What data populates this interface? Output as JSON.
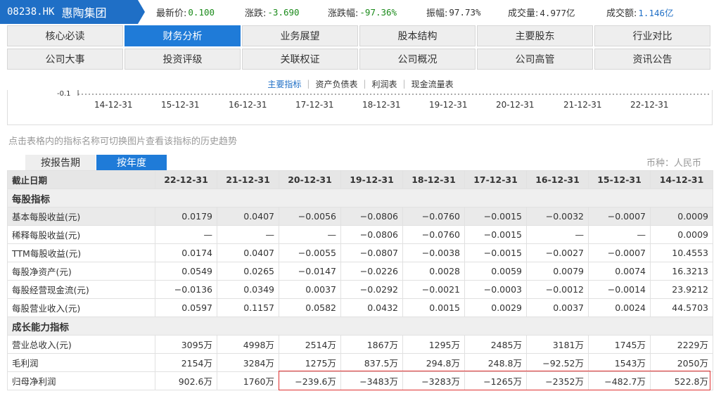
{
  "header": {
    "code": "08238.HK",
    "name": "惠陶集团",
    "quotes": [
      {
        "label": "最新价:",
        "value": "0.100",
        "color": "green"
      },
      {
        "label": "涨跌:",
        "value": "-3.690",
        "color": "green"
      },
      {
        "label": "涨跌幅:",
        "value": "-97.36%",
        "color": "green"
      },
      {
        "label": "振幅:",
        "value": "97.73%",
        "color": "plain"
      },
      {
        "label": "成交量:",
        "value": "4.977亿",
        "color": "plain"
      },
      {
        "label": "成交额:",
        "value": "1.146亿",
        "color": "blue"
      }
    ]
  },
  "nav": {
    "row1": [
      "核心必读",
      "财务分析",
      "业务展望",
      "股本结构",
      "主要股东",
      "行业对比"
    ],
    "row2": [
      "公司大事",
      "投资评级",
      "关联权证",
      "公司概况",
      "公司高管",
      "资讯公告"
    ],
    "active": "财务分析"
  },
  "subtabs": {
    "items": [
      "主要指标",
      "资产负债表",
      "利润表",
      "现金流量表"
    ],
    "active": "主要指标"
  },
  "chart": {
    "y_tick": "-0.1",
    "x_ticks": [
      "14-12-31",
      "15-12-31",
      "16-12-31",
      "17-12-31",
      "18-12-31",
      "19-12-31",
      "20-12-31",
      "21-12-31",
      "22-12-31"
    ]
  },
  "hint": "点击表格内的指标名称可切换图片查看该指标的历史趋势",
  "period_tabs": {
    "report": "按报告期",
    "year": "按年度",
    "active": "按年度"
  },
  "currency": "币种：人民币",
  "table": {
    "header_label": "截止日期",
    "dates": [
      "22-12-31",
      "21-12-31",
      "20-12-31",
      "19-12-31",
      "18-12-31",
      "17-12-31",
      "16-12-31",
      "15-12-31",
      "14-12-31"
    ],
    "groups": [
      {
        "title": "每股指标",
        "rows": [
          {
            "label": "基本每股收益(元)",
            "values": [
              "0.0179",
              "0.0407",
              "−0.0056",
              "−0.0806",
              "−0.0760",
              "−0.0015",
              "−0.0032",
              "−0.0007",
              "0.0009"
            ]
          },
          {
            "label": "稀释每股收益(元)",
            "values": [
              "—",
              "—",
              "—",
              "−0.0806",
              "−0.0760",
              "−0.0015",
              "—",
              "—",
              "0.0009"
            ]
          },
          {
            "label": "TTM每股收益(元)",
            "values": [
              "0.0174",
              "0.0407",
              "−0.0055",
              "−0.0807",
              "−0.0038",
              "−0.0015",
              "−0.0027",
              "−0.0007",
              "10.4553"
            ]
          },
          {
            "label": "每股净资产(元)",
            "values": [
              "0.0549",
              "0.0265",
              "−0.0147",
              "−0.0226",
              "0.0028",
              "0.0059",
              "0.0079",
              "0.0074",
              "16.3213"
            ]
          },
          {
            "label": "每股经营现金流(元)",
            "values": [
              "−0.0136",
              "0.0349",
              "0.0037",
              "−0.0292",
              "−0.0021",
              "−0.0003",
              "−0.0012",
              "−0.0014",
              "23.9212"
            ]
          },
          {
            "label": "每股营业收入(元)",
            "values": [
              "0.0597",
              "0.1157",
              "0.0582",
              "0.0432",
              "0.0015",
              "0.0029",
              "0.0037",
              "0.0024",
              "44.5703"
            ]
          }
        ]
      },
      {
        "title": "成长能力指标",
        "rows": [
          {
            "label": "营业总收入(元)",
            "values": [
              "3095万",
              "4998万",
              "2514万",
              "1867万",
              "1295万",
              "2485万",
              "3181万",
              "1745万",
              "2229万"
            ]
          },
          {
            "label": "毛利润",
            "values": [
              "2154万",
              "3284万",
              "1275万",
              "837.5万",
              "294.8万",
              "248.8万",
              "−92.52万",
              "1543万",
              "2050万"
            ]
          },
          {
            "label": "归母净利润",
            "values": [
              "902.6万",
              "1760万",
              "−239.6万",
              "−3483万",
              "−3283万",
              "−1265万",
              "−2352万",
              "−482.7万",
              "522.8万"
            ]
          }
        ]
      }
    ]
  }
}
